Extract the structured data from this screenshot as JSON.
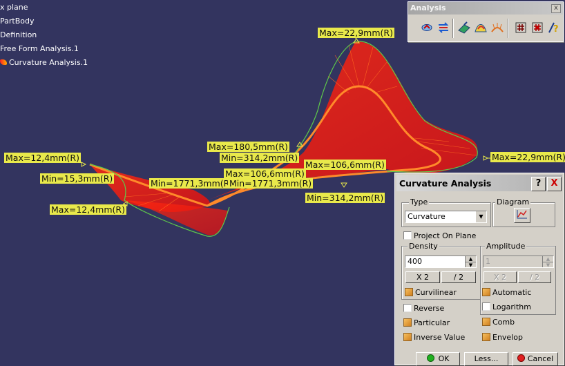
{
  "tree": {
    "items": [
      "x plane",
      "PartBody",
      "Definition",
      "Free Form Analysis.1",
      "Curvature Analysis.1"
    ]
  },
  "labels": [
    {
      "text": "Max=22,9mm(R)"
    },
    {
      "text": "Max=180,5mm(R)"
    },
    {
      "text": "Min=314,2mm(R)"
    },
    {
      "text": "Max=106,6mm(R)"
    },
    {
      "text": "Max=106,6mm(R)"
    },
    {
      "text": "Max=22,9mm(R)"
    },
    {
      "text": "Max=12,4mm(R)"
    },
    {
      "text": "Min=15,3mm(R)"
    },
    {
      "text": "Min=1771,3mm(R)"
    },
    {
      "text": "Min=1771,3mm(R)"
    },
    {
      "text": "Min=314,2mm(R)"
    },
    {
      "text": "Max=12,4mm(R)"
    }
  ],
  "toolbar": {
    "title": "Analysis",
    "close": "x",
    "icons": [
      "connect-checker-icon",
      "distance-analysis-icon",
      "draft-analysis-icon",
      "surfacic-curvature-icon",
      "porcupine-curvature-icon",
      "deviation-icon",
      "connection-icon",
      "help-icon"
    ]
  },
  "dialog": {
    "title": "Curvature Analysis",
    "help": "?",
    "close": "X",
    "type_label": "Type",
    "type_value": "Curvature",
    "diagram_label": "Diagram",
    "project_on_plane": "Project On Plane",
    "density_label": "Density",
    "density_value": "400",
    "amplitude_label": "Amplitude",
    "amplitude_value": "1",
    "x2": "X 2",
    "div2": "/ 2",
    "curvilinear": "Curvilinear",
    "automatic": "Automatic",
    "reverse": "Reverse",
    "logarithm": "Logarithm",
    "particular": "Particular",
    "comb": "Comb",
    "inverse_value": "Inverse Value",
    "envelop": "Envelop",
    "ok": "OK",
    "less": "Less...",
    "cancel": "Cancel"
  },
  "colors": {
    "background": "#33345f",
    "comb": "#ff1010",
    "curve": "#ff8a2a",
    "envelope": "#5ec94a",
    "label_bg": "#e9e94b"
  }
}
